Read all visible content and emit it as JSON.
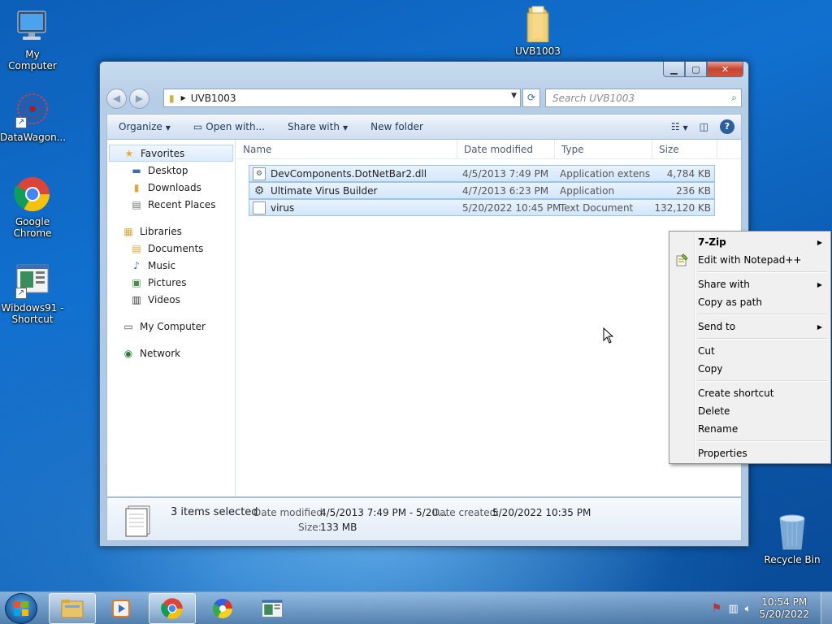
{
  "desktop": {
    "icons": [
      {
        "label": "My Computer"
      },
      {
        "label": "DataWagon..."
      },
      {
        "label": "Google Chrome"
      },
      {
        "label": "Wibdows91 - Shortcut"
      },
      {
        "label": "UVB1003"
      },
      {
        "label": "Recycle Bin"
      }
    ]
  },
  "window": {
    "address": {
      "crumb": "UVB1003"
    },
    "search": {
      "placeholder": "Search UVB1003"
    },
    "toolbar": {
      "organize": "Organize",
      "open_with": "Open with...",
      "share_with": "Share with",
      "new_folder": "New folder"
    },
    "nav": {
      "favorites": "Favorites",
      "desktop": "Desktop",
      "downloads": "Downloads",
      "recent_places": "Recent Places",
      "libraries": "Libraries",
      "documents": "Documents",
      "music": "Music",
      "pictures": "Pictures",
      "videos": "Videos",
      "my_computer": "My Computer",
      "network": "Network"
    },
    "columns": {
      "name": "Name",
      "date": "Date modified",
      "type": "Type",
      "size": "Size"
    },
    "files": [
      {
        "name": "DevComponents.DotNetBar2.dll",
        "date": "4/5/2013 7:49 PM",
        "type": "Application extens...",
        "size": "4,784 KB"
      },
      {
        "name": "Ultimate Virus Builder",
        "date": "4/7/2013 6:23 PM",
        "type": "Application",
        "size": "236 KB"
      },
      {
        "name": "virus",
        "date": "5/20/2022 10:45 PM",
        "type": "Text Document",
        "size": "132,120 KB"
      }
    ],
    "details": {
      "selected": "3 items selected",
      "date_modified_label": "Date modified:",
      "date_modified_value": "4/5/2013 7:49 PM - 5/20...",
      "date_created_label": "Date created:",
      "date_created_value": "5/20/2022 10:35 PM",
      "size_label": "Size:",
      "size_value": "133 MB"
    }
  },
  "context_menu": {
    "seven_zip": "7-Zip",
    "edit_notepad": "Edit with Notepad++",
    "share_with": "Share with",
    "copy_as_path": "Copy as path",
    "send_to": "Send to",
    "cut": "Cut",
    "copy": "Copy",
    "create_shortcut": "Create shortcut",
    "delete": "Delete",
    "rename": "Rename",
    "properties": "Properties"
  },
  "taskbar": {
    "time": "10:54 PM",
    "date": "5/20/2022"
  },
  "colors": {
    "desktop_blue": "#1170cf",
    "selection_border": "#99c4ee",
    "close_red": "#c7452f"
  }
}
